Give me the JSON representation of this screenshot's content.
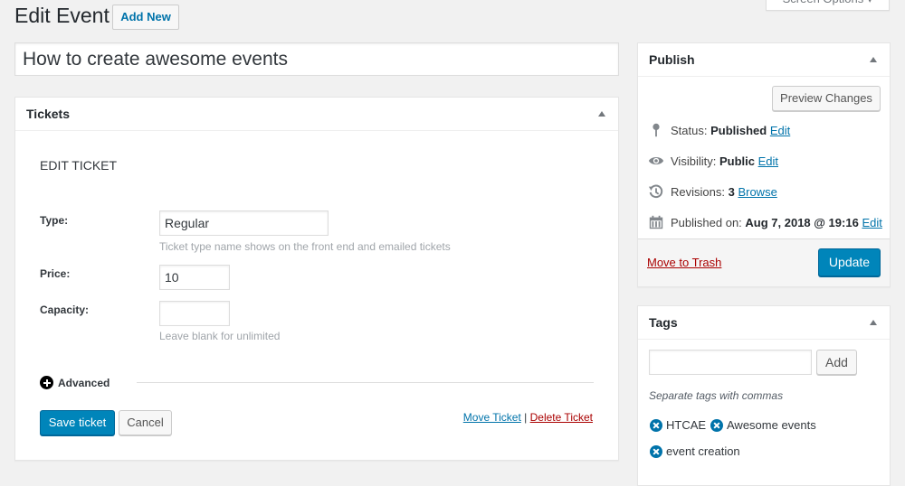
{
  "header": {
    "title": "Edit Event",
    "add_new_label": "Add New",
    "screen_options_label": "Screen Options"
  },
  "post": {
    "title_value": "How to create awesome events"
  },
  "tickets": {
    "panel_title": "Tickets",
    "heading": "EDIT TICKET",
    "fields": {
      "type_label": "Type:",
      "type_value": "Regular",
      "type_hint": "Ticket type name shows on the front end and emailed tickets",
      "price_label": "Price:",
      "price_value": "10",
      "capacity_label": "Capacity:",
      "capacity_value": "",
      "capacity_hint": "Leave blank for unlimited"
    },
    "advanced_label": "Advanced",
    "save_label": "Save ticket",
    "cancel_label": "Cancel",
    "move_label": "Move Ticket",
    "separator": "|",
    "delete_label": "Delete Ticket"
  },
  "publish": {
    "panel_title": "Publish",
    "preview_label": "Preview Changes",
    "status_label": "Status:",
    "status_value": "Published",
    "status_edit": "Edit",
    "visibility_label": "Visibility:",
    "visibility_value": "Public",
    "visibility_edit": "Edit",
    "revisions_label": "Revisions:",
    "revisions_value": "3",
    "revisions_browse": "Browse",
    "published_label": "Published on:",
    "published_value": "Aug 7, 2018 @ 19:16",
    "published_edit": "Edit",
    "trash_label": "Move to Trash",
    "update_label": "Update"
  },
  "tags": {
    "panel_title": "Tags",
    "input_value": "",
    "add_label": "Add",
    "hint": "Separate tags with commas",
    "items": [
      {
        "label": "HTCAE"
      },
      {
        "label": "Awesome events"
      },
      {
        "label": "event creation"
      }
    ]
  },
  "colors": {
    "primary": "#0085ba",
    "link": "#0073aa",
    "danger": "#a00000",
    "background": "#f1f1f1"
  }
}
